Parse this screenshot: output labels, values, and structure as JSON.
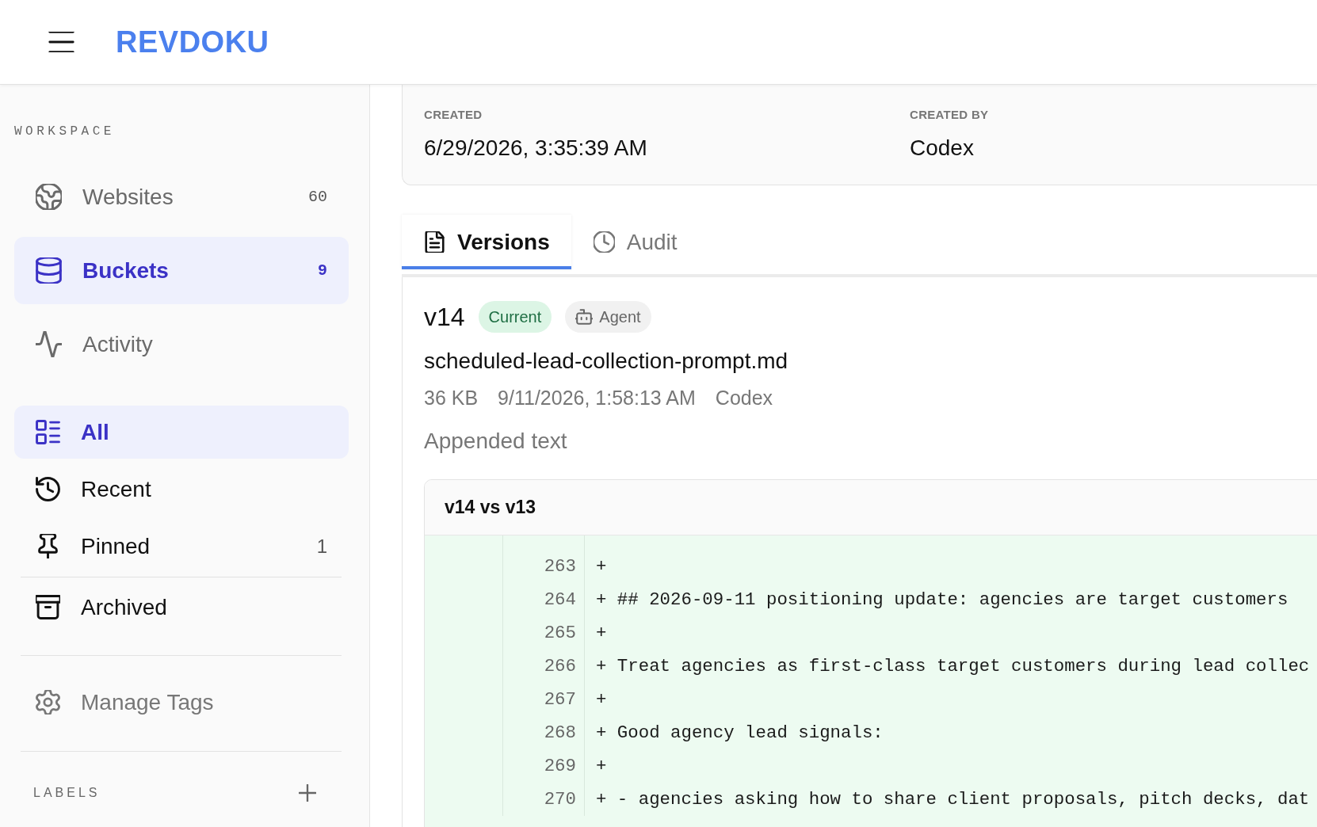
{
  "header": {
    "logo": "REVDOKU"
  },
  "sidebar": {
    "workspace": {
      "title": "WORKSPACE",
      "items": [
        {
          "label": "Websites",
          "count": "60",
          "selected": false
        },
        {
          "label": "Buckets",
          "count": "9",
          "selected": true
        },
        {
          "label": "Activity",
          "selected": false
        }
      ]
    },
    "filters": [
      {
        "label": "All",
        "selected": true
      },
      {
        "label": "Recent",
        "selected": false
      },
      {
        "label": "Pinned",
        "count": "1",
        "selected": false
      }
    ],
    "archived": {
      "label": "Archived",
      "selected": false
    },
    "manage_tags": {
      "label": "Manage Tags"
    },
    "labels": {
      "title": "LABELS"
    }
  },
  "details": [
    {
      "label": "CREATED",
      "value": "6/29/2026, 3:35:39 AM"
    },
    {
      "label": "CREATED BY",
      "value": "Codex"
    }
  ],
  "tabs": [
    {
      "label": "Versions",
      "selected": true
    },
    {
      "label": "Audit",
      "selected": false
    }
  ],
  "version": {
    "name": "v14",
    "badges": [
      {
        "label": "Current",
        "kind": "status"
      },
      {
        "label": "Agent",
        "kind": "source"
      }
    ],
    "filename": "scheduled-lead-collection-prompt.md",
    "meta": [
      "36 KB",
      "9/11/2026, 1:58:13 AM",
      "Codex"
    ],
    "summary": "Appended text",
    "diff": {
      "title": "v14 vs v13",
      "rows": [
        {
          "number": "263",
          "text": "+"
        },
        {
          "number": "264",
          "text": "+ ## 2026-09-11 positioning update: agencies are target customers"
        },
        {
          "number": "265",
          "text": "+"
        },
        {
          "number": "266",
          "text": "+ Treat agencies as first-class target customers during lead collec"
        },
        {
          "number": "267",
          "text": "+"
        },
        {
          "number": "268",
          "text": "+ Good agency lead signals:"
        },
        {
          "number": "269",
          "text": "+"
        },
        {
          "number": "270",
          "text": "+ - agencies asking how to share client proposals, pitch decks, dat"
        }
      ]
    }
  }
}
